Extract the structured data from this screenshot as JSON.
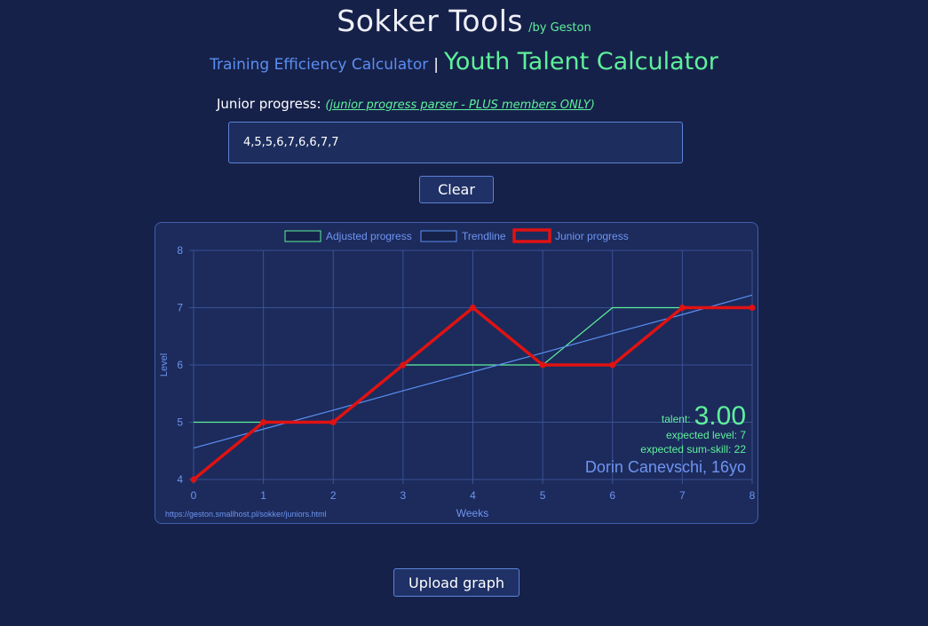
{
  "header": {
    "title": "Sokker Tools",
    "byline": "/by Geston"
  },
  "nav": {
    "training_link": "Training Efficiency Calculator",
    "separator": "|",
    "youth_link": "Youth Talent Calculator"
  },
  "form": {
    "progress_label": "Junior progress:",
    "parser_prefix": "(",
    "parser_link": "junior progress parser - PLUS members ONLY",
    "parser_suffix": ")",
    "progress_value": "4,5,5,6,7,6,6,7,7",
    "clear_label": "Clear"
  },
  "upload_label": "Upload graph",
  "colors": {
    "background": "#16214a",
    "panel": "#1c2b5c",
    "accent_green": "#5ef19a",
    "link_blue": "#5b8ff0",
    "junior_red": "#e01212",
    "trend_blue": "#5b8ff0",
    "axis_text": "#6f94f0"
  },
  "chart_data": {
    "type": "line",
    "x": [
      0,
      1,
      2,
      3,
      4,
      5,
      6,
      7,
      8
    ],
    "xlabel": "Weeks",
    "ylabel": "Level",
    "xlim": [
      0,
      8
    ],
    "ylim": [
      4,
      8
    ],
    "x_ticks": [
      "0",
      "1",
      "2",
      "3",
      "4",
      "5",
      "6",
      "7",
      "8"
    ],
    "y_ticks": [
      "4",
      "5",
      "6",
      "7",
      "8"
    ],
    "grid": true,
    "legend_position": "top-center",
    "series": [
      {
        "name": "Adjusted progress",
        "values": [
          5,
          5,
          5,
          6,
          6,
          6,
          7,
          7,
          7
        ],
        "color": "#5ef19a"
      },
      {
        "name": "Trendline",
        "values": [
          4.55,
          4.88,
          5.21,
          5.55,
          5.88,
          6.21,
          6.55,
          6.88,
          7.22
        ],
        "color": "#5b8ff0"
      },
      {
        "name": "Junior progress",
        "values": [
          4,
          5,
          5,
          6,
          7,
          6,
          6,
          7,
          7
        ],
        "color": "#e01212"
      }
    ],
    "annotations": {
      "talent_label": "talent:",
      "talent_value": "3.00",
      "expected_level": "expected level: 7",
      "expected_sum_skill": "expected sum-skill: 22",
      "player": "Dorin Canevschi, 16yo",
      "url": "https://geston.smallhost.pl/sokker/juniors.html"
    }
  }
}
